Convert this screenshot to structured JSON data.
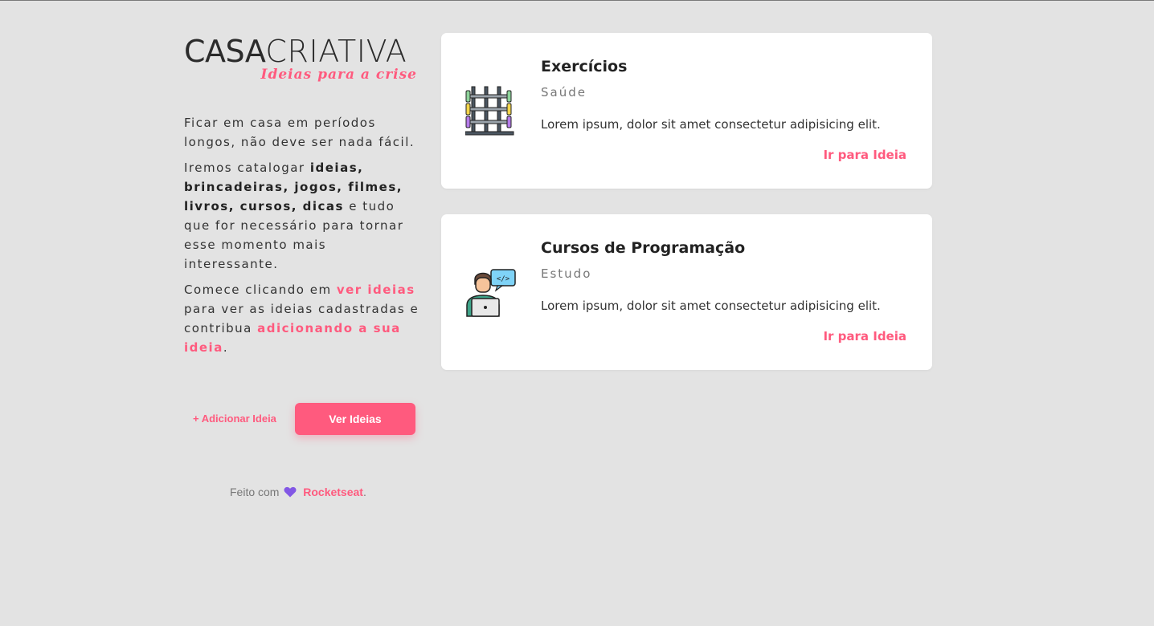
{
  "logo": {
    "casa": "CASA",
    "criativa": "CRIATIVA",
    "subtitle": "Ideias para a crise"
  },
  "intro": {
    "p1": "Ficar em casa em períodos longos, não deve ser nada fácil.",
    "p2_a": "Iremos catalogar ",
    "p2_bold": "ideias, brincadeiras, jogos, filmes, livros, cursos, dicas",
    "p2_b": " e tudo que for necessário para tornar esse momento mais interessante.",
    "p3_a": "Comece clicando em ",
    "p3_link1": "ver ideias",
    "p3_b": " para ver as ideias cadastradas e contribua ",
    "p3_link2": "adicionando a sua ideia",
    "p3_c": "."
  },
  "actions": {
    "add_label": "+ Adicionar Ideia",
    "view_label": "Ver Ideias"
  },
  "footer": {
    "made_with": "Feito com",
    "brand": "Rocketseat",
    "period": "."
  },
  "cards": [
    {
      "title": "Exercícios",
      "category": "Saúde",
      "description": "Lorem ipsum, dolor sit amet consectetur adipisicing elit.",
      "link": "Ir para Ideia",
      "icon": "gym-rack-icon"
    },
    {
      "title": "Cursos de Programação",
      "category": "Estudo",
      "description": "Lorem ipsum, dolor sit amet consectetur adipisicing elit.",
      "link": "Ir para Ideia",
      "icon": "programmer-icon"
    }
  ],
  "colors": {
    "accent": "#ff5a7e",
    "background": "#e3e3e3",
    "heart": "#8257e5"
  }
}
